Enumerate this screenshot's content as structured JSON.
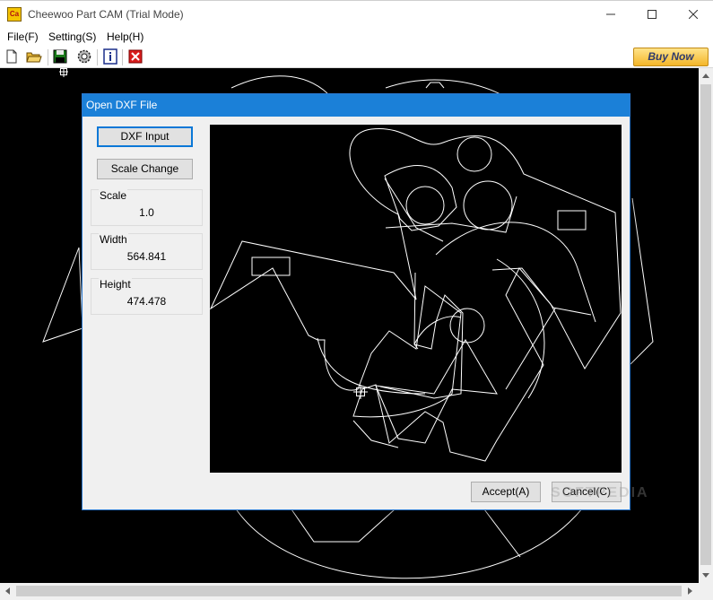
{
  "window": {
    "title": "Cheewoo Part CAM (Trial Mode)",
    "app_icon_text": "Ca",
    "controls": {
      "minimize_icon": "minimize-icon",
      "maximize_icon": "maximize-icon",
      "close_icon": "close-icon"
    }
  },
  "menu": {
    "file": "File(F)",
    "setting": "Setting(S)",
    "help": "Help(H)"
  },
  "toolbar": {
    "icons": [
      "new-file-icon",
      "open-folder-icon",
      "save-disk-icon",
      "settings-gear-icon",
      "info-icon",
      "exit-icon"
    ],
    "buy_now": "Buy Now"
  },
  "dialog": {
    "title": "Open DXF File",
    "dxf_input": "DXF Input",
    "scale_change": "Scale Change",
    "scale": {
      "label": "Scale",
      "value": "1.0"
    },
    "width": {
      "label": "Width",
      "value": "564.841"
    },
    "height": {
      "label": "Height",
      "value": "474.478"
    },
    "accept": "Accept(A)",
    "cancel": "Cancel(C)"
  },
  "watermark": "SOFTPEDIA",
  "colors": {
    "canvas_bg": "#000000",
    "drawing_lines": "#ffffff",
    "dialog_title_bg": "#1b80d8",
    "buy_now_bg": "#f4b629",
    "focus_border": "#0a78d7"
  }
}
